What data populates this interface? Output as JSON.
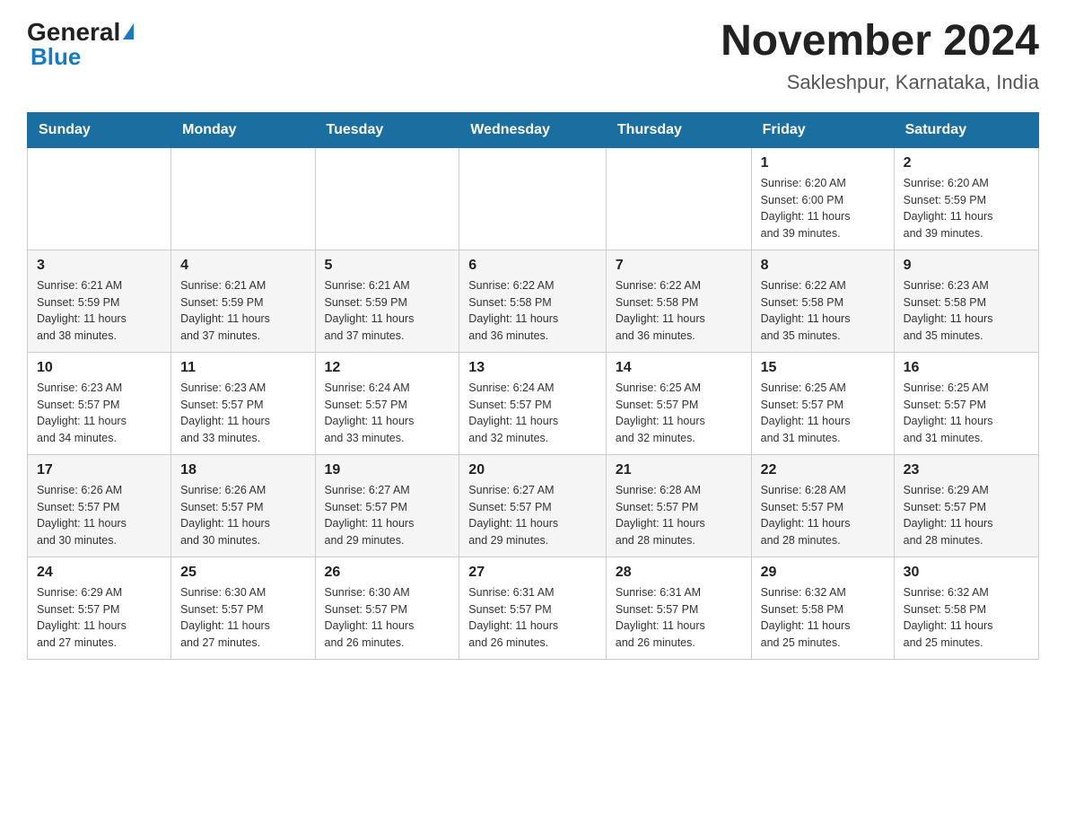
{
  "header": {
    "logo": {
      "general": "General",
      "blue": "Blue"
    },
    "title": "November 2024",
    "subtitle": "Sakleshpur, Karnataka, India"
  },
  "calendar": {
    "weekdays": [
      "Sunday",
      "Monday",
      "Tuesday",
      "Wednesday",
      "Thursday",
      "Friday",
      "Saturday"
    ],
    "weeks": [
      [
        {
          "day": "",
          "info": ""
        },
        {
          "day": "",
          "info": ""
        },
        {
          "day": "",
          "info": ""
        },
        {
          "day": "",
          "info": ""
        },
        {
          "day": "",
          "info": ""
        },
        {
          "day": "1",
          "info": "Sunrise: 6:20 AM\nSunset: 6:00 PM\nDaylight: 11 hours\nand 39 minutes."
        },
        {
          "day": "2",
          "info": "Sunrise: 6:20 AM\nSunset: 5:59 PM\nDaylight: 11 hours\nand 39 minutes."
        }
      ],
      [
        {
          "day": "3",
          "info": "Sunrise: 6:21 AM\nSunset: 5:59 PM\nDaylight: 11 hours\nand 38 minutes."
        },
        {
          "day": "4",
          "info": "Sunrise: 6:21 AM\nSunset: 5:59 PM\nDaylight: 11 hours\nand 37 minutes."
        },
        {
          "day": "5",
          "info": "Sunrise: 6:21 AM\nSunset: 5:59 PM\nDaylight: 11 hours\nand 37 minutes."
        },
        {
          "day": "6",
          "info": "Sunrise: 6:22 AM\nSunset: 5:58 PM\nDaylight: 11 hours\nand 36 minutes."
        },
        {
          "day": "7",
          "info": "Sunrise: 6:22 AM\nSunset: 5:58 PM\nDaylight: 11 hours\nand 36 minutes."
        },
        {
          "day": "8",
          "info": "Sunrise: 6:22 AM\nSunset: 5:58 PM\nDaylight: 11 hours\nand 35 minutes."
        },
        {
          "day": "9",
          "info": "Sunrise: 6:23 AM\nSunset: 5:58 PM\nDaylight: 11 hours\nand 35 minutes."
        }
      ],
      [
        {
          "day": "10",
          "info": "Sunrise: 6:23 AM\nSunset: 5:57 PM\nDaylight: 11 hours\nand 34 minutes."
        },
        {
          "day": "11",
          "info": "Sunrise: 6:23 AM\nSunset: 5:57 PM\nDaylight: 11 hours\nand 33 minutes."
        },
        {
          "day": "12",
          "info": "Sunrise: 6:24 AM\nSunset: 5:57 PM\nDaylight: 11 hours\nand 33 minutes."
        },
        {
          "day": "13",
          "info": "Sunrise: 6:24 AM\nSunset: 5:57 PM\nDaylight: 11 hours\nand 32 minutes."
        },
        {
          "day": "14",
          "info": "Sunrise: 6:25 AM\nSunset: 5:57 PM\nDaylight: 11 hours\nand 32 minutes."
        },
        {
          "day": "15",
          "info": "Sunrise: 6:25 AM\nSunset: 5:57 PM\nDaylight: 11 hours\nand 31 minutes."
        },
        {
          "day": "16",
          "info": "Sunrise: 6:25 AM\nSunset: 5:57 PM\nDaylight: 11 hours\nand 31 minutes."
        }
      ],
      [
        {
          "day": "17",
          "info": "Sunrise: 6:26 AM\nSunset: 5:57 PM\nDaylight: 11 hours\nand 30 minutes."
        },
        {
          "day": "18",
          "info": "Sunrise: 6:26 AM\nSunset: 5:57 PM\nDaylight: 11 hours\nand 30 minutes."
        },
        {
          "day": "19",
          "info": "Sunrise: 6:27 AM\nSunset: 5:57 PM\nDaylight: 11 hours\nand 29 minutes."
        },
        {
          "day": "20",
          "info": "Sunrise: 6:27 AM\nSunset: 5:57 PM\nDaylight: 11 hours\nand 29 minutes."
        },
        {
          "day": "21",
          "info": "Sunrise: 6:28 AM\nSunset: 5:57 PM\nDaylight: 11 hours\nand 28 minutes."
        },
        {
          "day": "22",
          "info": "Sunrise: 6:28 AM\nSunset: 5:57 PM\nDaylight: 11 hours\nand 28 minutes."
        },
        {
          "day": "23",
          "info": "Sunrise: 6:29 AM\nSunset: 5:57 PM\nDaylight: 11 hours\nand 28 minutes."
        }
      ],
      [
        {
          "day": "24",
          "info": "Sunrise: 6:29 AM\nSunset: 5:57 PM\nDaylight: 11 hours\nand 27 minutes."
        },
        {
          "day": "25",
          "info": "Sunrise: 6:30 AM\nSunset: 5:57 PM\nDaylight: 11 hours\nand 27 minutes."
        },
        {
          "day": "26",
          "info": "Sunrise: 6:30 AM\nSunset: 5:57 PM\nDaylight: 11 hours\nand 26 minutes."
        },
        {
          "day": "27",
          "info": "Sunrise: 6:31 AM\nSunset: 5:57 PM\nDaylight: 11 hours\nand 26 minutes."
        },
        {
          "day": "28",
          "info": "Sunrise: 6:31 AM\nSunset: 5:57 PM\nDaylight: 11 hours\nand 26 minutes."
        },
        {
          "day": "29",
          "info": "Sunrise: 6:32 AM\nSunset: 5:58 PM\nDaylight: 11 hours\nand 25 minutes."
        },
        {
          "day": "30",
          "info": "Sunrise: 6:32 AM\nSunset: 5:58 PM\nDaylight: 11 hours\nand 25 minutes."
        }
      ]
    ]
  }
}
